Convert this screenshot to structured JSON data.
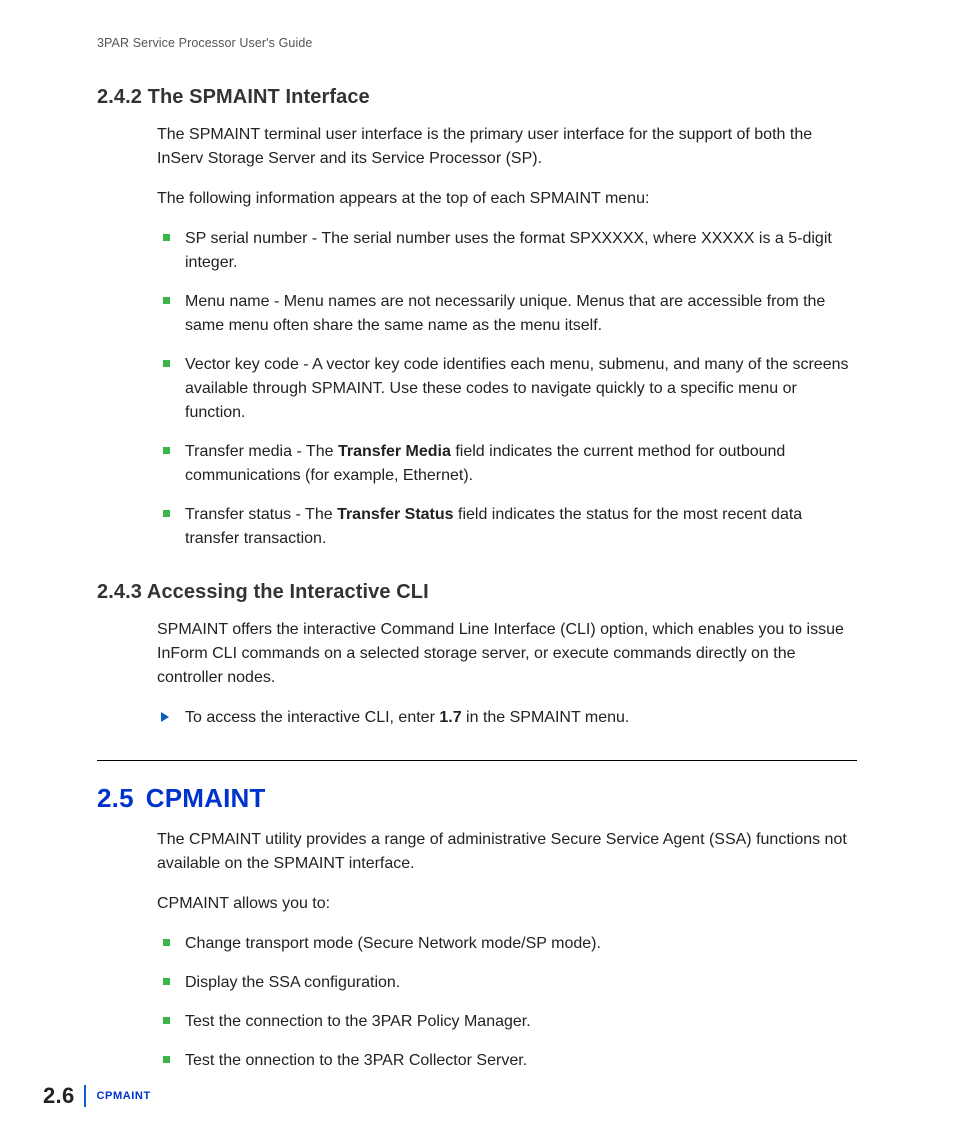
{
  "runningHead": "3PAR Service Processor User's Guide",
  "s242": {
    "heading": "2.4.2 The SPMAINT Interface",
    "p1": "The SPMAINT terminal user interface is the primary user interface for the support of both the InServ Storage Server and its Service Processor (SP).",
    "p2": "The following information appears at the top of each SPMAINT menu:",
    "b1": "SP serial number - The serial number uses the format SPXXXXX, where XXXXX is a 5-digit integer.",
    "b2": "Menu name - Menu names are not necessarily unique. Menus that are accessible from the same menu often share the same name as the menu itself.",
    "b3": "Vector key code - A vector key code identifies each menu, submenu, and many of the screens available through SPMAINT. Use these codes to navigate quickly to a specific menu or function.",
    "b4a": "Transfer media - The ",
    "b4bold": "Transfer Media",
    "b4b": " field indicates the current method for outbound communications (for example, Ethernet).",
    "b5a": "Transfer status - The ",
    "b5bold": "Transfer Status",
    "b5b": " field indicates the status for the most recent data transfer transaction."
  },
  "s243": {
    "heading": "2.4.3 Accessing the Interactive CLI",
    "p1": "SPMAINT offers the interactive Command Line Interface (CLI) option, which enables you to issue InForm CLI commands on a selected storage server, or execute commands directly on the controller nodes.",
    "step_a": "To access the interactive CLI, enter ",
    "step_bold": "1.7",
    "step_b": " in the SPMAINT menu."
  },
  "s25": {
    "num": "2.5",
    "title": "CPMAINT",
    "p1": "The CPMAINT utility provides a range of administrative Secure Service Agent (SSA) functions not available on the SPMAINT interface.",
    "p2": "CPMAINT allows you to:",
    "b1": "Change transport mode (Secure Network mode/SP mode).",
    "b2": "Display the SSA configuration.",
    "b3": "Test the connection to the 3PAR Policy Manager.",
    "b4": "Test the onnection to the 3PAR Collector Server."
  },
  "footer": {
    "pageNum": "2.6",
    "section": "CPMAINT"
  }
}
